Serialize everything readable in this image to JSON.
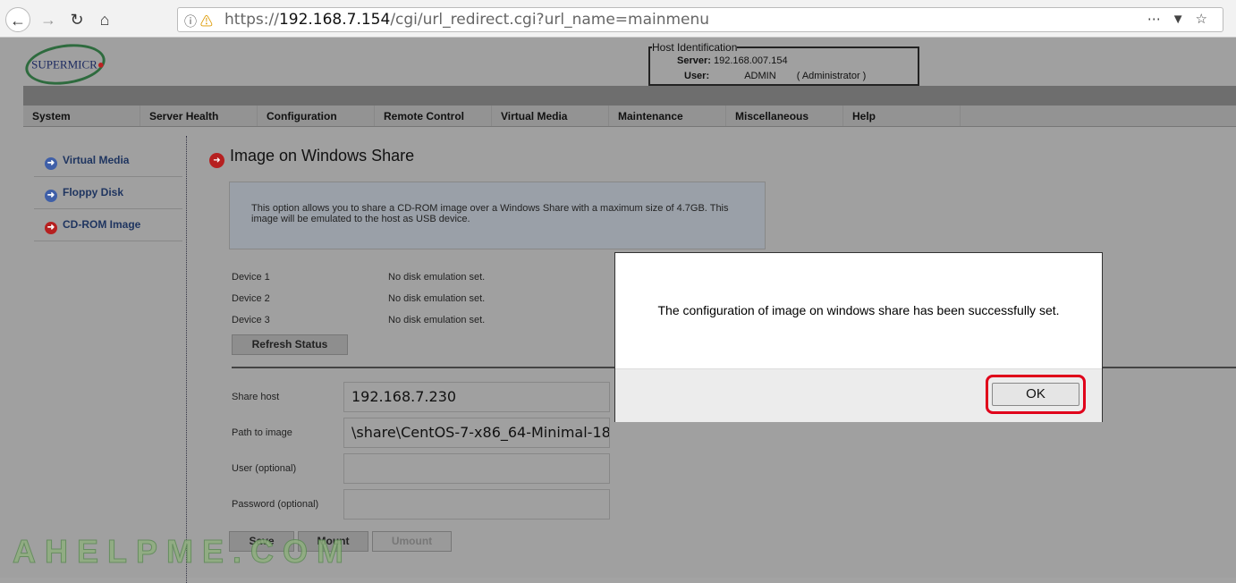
{
  "browser": {
    "url_host": "192.168.7.154",
    "url_prefix": "https://",
    "url_path": "/cgi/url_redirect.cgi?url_name=mainmenu"
  },
  "logo": "SUPERMICRO",
  "host": {
    "legend": "Host Identification",
    "server_label": "Server:",
    "server": "192.168.007.154",
    "user_label": "User:",
    "user": "ADMIN",
    "role": "( Administrator )"
  },
  "menu": [
    "System",
    "Server Health",
    "Configuration",
    "Remote Control",
    "Virtual Media",
    "Maintenance",
    "Miscellaneous",
    "Help"
  ],
  "sidebar": [
    {
      "label": "Virtual Media"
    },
    {
      "label": "Floppy Disk"
    },
    {
      "label": "CD-ROM Image"
    }
  ],
  "main": {
    "title": "Image on Windows Share",
    "info": "This option allows you to share a CD-ROM image over a Windows Share with a maximum size of 4.7GB. This image will be emulated to the host as USB device.",
    "devices": [
      {
        "name": "Device 1",
        "status": "No disk emulation set."
      },
      {
        "name": "Device 2",
        "status": "No disk emulation set."
      },
      {
        "name": "Device 3",
        "status": "No disk emulation set."
      }
    ],
    "refresh": "Refresh Status",
    "fields": [
      {
        "label": "Share host",
        "value": "192.168.7.230"
      },
      {
        "label": "Path to image",
        "value": "\\share\\CentOS-7-x86_64-Minimal-18"
      },
      {
        "label": "User (optional)",
        "value": ""
      },
      {
        "label": "Password (optional)",
        "value": ""
      }
    ],
    "save": "Save",
    "mount": "Mount",
    "umount": "Umount"
  },
  "watermark": "AHELPME.COM",
  "dialog": {
    "message": "The configuration of image on windows share has been successfully set.",
    "ok": "OK"
  }
}
